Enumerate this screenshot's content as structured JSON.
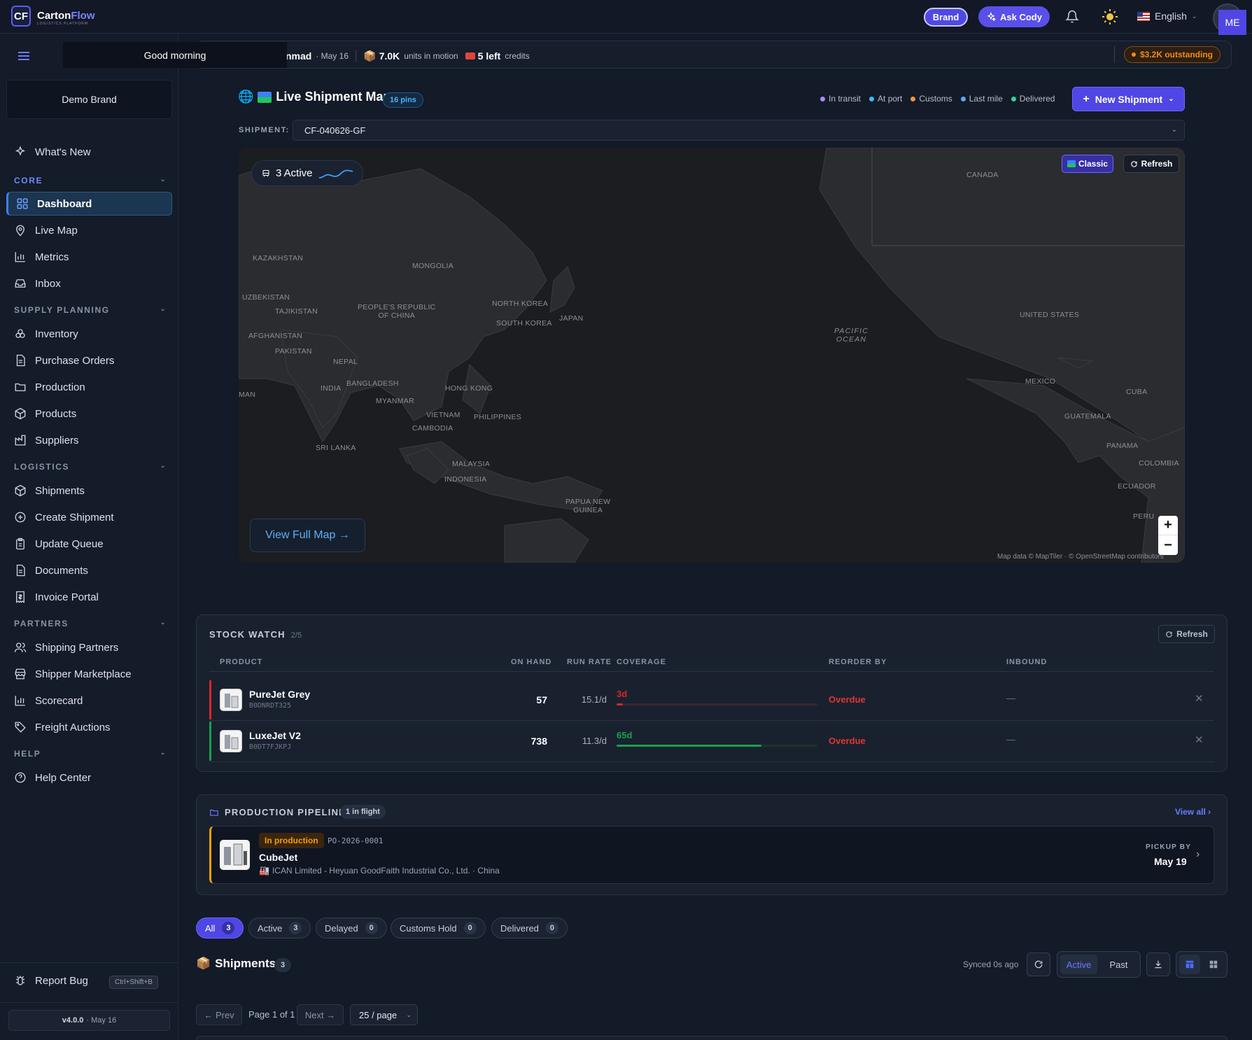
{
  "app": {
    "logo_mark": "CF",
    "name_part1": "Carton",
    "name_part2": "Flow",
    "tagline": "LOGISTICS PLATFORM"
  },
  "topbar": {
    "brand_label": "Brand",
    "ask_cody_label": "Ask Cody",
    "language": "English",
    "avatar_initials": "ME"
  },
  "greeting": {
    "tooltip": "Good morning",
    "name": "nmad",
    "date": "· May 16",
    "units_value": "7.0K",
    "units_label": "units in motion",
    "credits_value": "5 left",
    "credits_label": "credits",
    "outstanding": "$3.2K outstanding"
  },
  "sidebar": {
    "brand_selector": "Demo Brand",
    "whats_new": "What's New",
    "sections": {
      "core": "CORE",
      "supply": "SUPPLY PLANNING",
      "logistics": "LOGISTICS",
      "partners": "PARTNERS",
      "help": "HELP"
    },
    "items": {
      "dashboard": "Dashboard",
      "live_map": "Live Map",
      "metrics": "Metrics",
      "inbox": "Inbox",
      "inventory": "Inventory",
      "purchase_orders": "Purchase Orders",
      "production": "Production",
      "products": "Products",
      "suppliers": "Suppliers",
      "shipments": "Shipments",
      "create_shipment": "Create Shipment",
      "update_queue": "Update Queue",
      "documents": "Documents",
      "invoice_portal": "Invoice Portal",
      "shipping_partners": "Shipping Partners",
      "shipper_marketplace": "Shipper Marketplace",
      "scorecard": "Scorecard",
      "freight_auctions": "Freight Auctions",
      "help_center": "Help Center"
    },
    "report_bug": "Report Bug",
    "report_shortcut": "Ctrl+Shift+B",
    "version": "v4.0.0",
    "version_date": "· May 16"
  },
  "map_section": {
    "title": "Live Shipment Map",
    "pins_badge": "16 pins",
    "legend": [
      {
        "label": "In transit",
        "color": "#a78bfa"
      },
      {
        "label": "At port",
        "color": "#38bdf8"
      },
      {
        "label": "Customs",
        "color": "#fb923c"
      },
      {
        "label": "Last mile",
        "color": "#60a5fa"
      },
      {
        "label": "Delivered",
        "color": "#34d399"
      }
    ],
    "new_shipment_label": "New Shipment",
    "shipment_label": "SHIPMENT:",
    "shipment_value": "CF-040626-GF",
    "active_label": "3 Active",
    "classic_label": "Classic",
    "refresh_label": "Refresh",
    "view_full_label": "View Full Map →",
    "attribution": "Map data © MapTiler · © OpenStreetMap contributors",
    "zoom_in": "+",
    "zoom_out": "−",
    "labels": {
      "canada": "CANADA",
      "kazakhstan": "KAZAKHSTAN",
      "mongolia": "MONGOLIA",
      "uzbekistan": "UZBEKISTAN",
      "tajikistan": "TAJIKISTAN",
      "china": "PEOPLE'S REPUBLIC\nOF CHINA",
      "north_korea": "NORTH KOREA",
      "south_korea": "SOUTH KOREA",
      "japan": "JAPAN",
      "afghanistan": "AFGHANISTAN",
      "pakistan": "PAKISTAN",
      "nepal": "NEPAL",
      "india": "INDIA",
      "bangladesh": "BANGLADESH",
      "hong_kong": "HONG KONG",
      "myanmar": "MYANMAR",
      "vietnam": "VIETNAM",
      "philippines": "PHILIPPINES",
      "cambodia": "CAMBODIA",
      "sri_lanka": "SRI LANKA",
      "malaysia": "MALAYSIA",
      "indonesia": "INDONESIA",
      "papua": "PAPUA NEW\nGUINEA",
      "pacific": "PACIFIC\nOCEAN",
      "usa": "UNITED STATES",
      "mexico": "MEXICO",
      "cuba": "CUBA",
      "guatemala": "GUATEMALA",
      "panama": "PANAMA",
      "colombia": "COLOMBIA",
      "ecuador": "ECUADOR",
      "peru": "PERU",
      "oman": "MAN"
    }
  },
  "stock_watch": {
    "title": "STOCK WATCH",
    "count": "2/5",
    "refresh_label": "Refresh",
    "columns": {
      "product": "PRODUCT",
      "on_hand": "ON HAND",
      "run_rate": "RUN RATE",
      "coverage": "COVERAGE",
      "reorder_by": "REORDER BY",
      "inbound": "INBOUND"
    },
    "rows": [
      {
        "name": "PureJet Grey",
        "sku": "B0DNRDT325",
        "on_hand": "57",
        "run_rate": "15.1/d",
        "coverage": "3d",
        "coverage_pct": 3,
        "reorder": "Overdue",
        "inbound": "—",
        "status_color": "#dc2626"
      },
      {
        "name": "LuxeJet V2",
        "sku": "B0DT7FJKPJ",
        "on_hand": "738",
        "run_rate": "11.3/d",
        "coverage": "65d",
        "coverage_pct": 72,
        "reorder": "Overdue",
        "inbound": "—",
        "status_color": "#16a34a"
      }
    ]
  },
  "pipeline": {
    "title": "PRODUCTION PIPELINE",
    "badge": "1 in flight",
    "view_all": "View all",
    "card": {
      "status": "In production",
      "po": "PO-2026-0001",
      "product": "CubeJet",
      "supplier": "ICAN Limited - Heyuan GoodFaith Industrial Co., Ltd. · China",
      "pickup_label": "PICKUP BY",
      "pickup_date": "May 19"
    }
  },
  "filters": [
    {
      "label": "All",
      "count": "3"
    },
    {
      "label": "Active",
      "count": "3"
    },
    {
      "label": "Delayed",
      "count": "0"
    },
    {
      "label": "Customs Hold",
      "count": "0"
    },
    {
      "label": "Delivered",
      "count": "0"
    }
  ],
  "shipments": {
    "title": "Shipments",
    "count": "3",
    "synced": "Synced 0s ago",
    "seg_active": "Active",
    "seg_past": "Past"
  },
  "pagination": {
    "prev": "← Prev",
    "info": "Page 1 of 1",
    "next": "Next →",
    "per_page": "25 / page"
  }
}
